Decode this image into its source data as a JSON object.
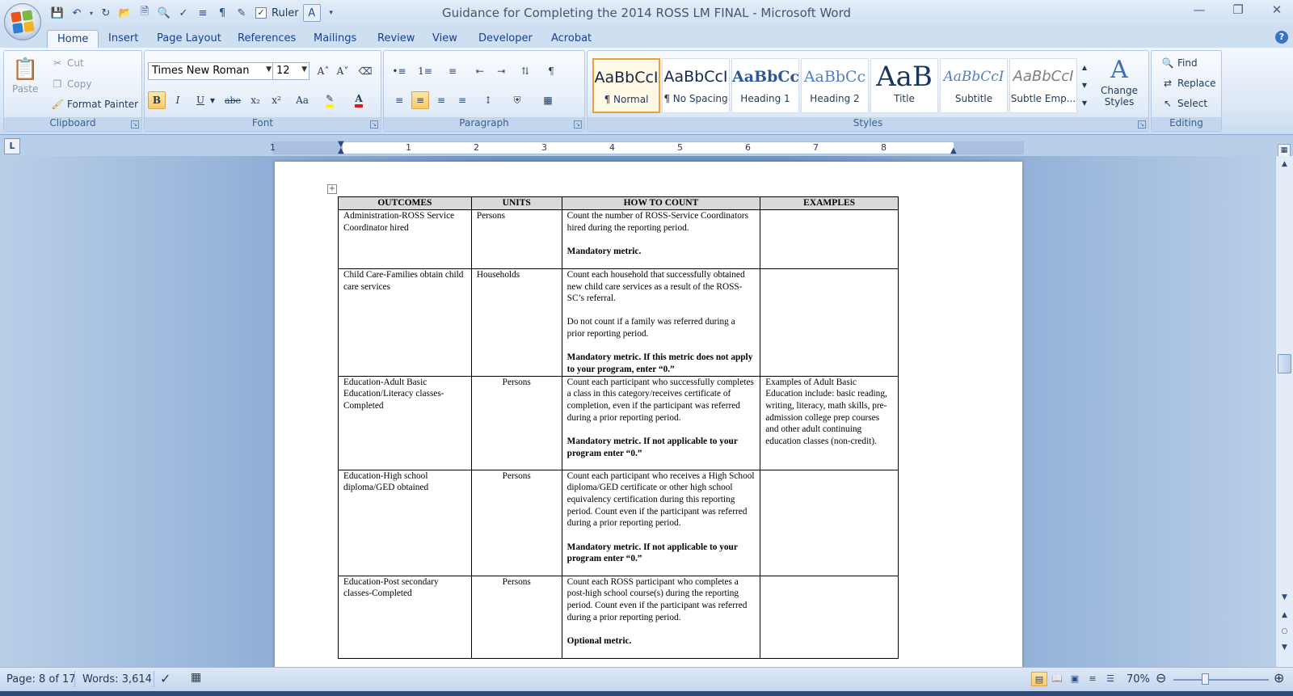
{
  "window": {
    "title": "Guidance for Completing the 2014 ROSS LM FINAL - Microsoft Word",
    "controls": [
      "—",
      "❐",
      "✕"
    ]
  },
  "qat": {
    "ruler_label": "Ruler"
  },
  "tabs": [
    "Home",
    "Insert",
    "Page Layout",
    "References",
    "Mailings",
    "Review",
    "View",
    "Developer",
    "Acrobat"
  ],
  "ribbon": {
    "clipboard": {
      "label": "Clipboard",
      "paste": "Paste",
      "cut": "Cut",
      "copy": "Copy",
      "format_painter": "Format Painter"
    },
    "font": {
      "label": "Font",
      "family": "Times New Roman",
      "size": "12",
      "bold": "B",
      "italic": "I",
      "underline": "U",
      "strike": "abe",
      "subscript": "x₂",
      "superscript": "x²",
      "case": "Aa",
      "grow": "A˄",
      "shrink": "A˅"
    },
    "paragraph": {
      "label": "Paragraph"
    },
    "styles": {
      "label": "Styles",
      "items": [
        {
          "sample": "AaBbCcI",
          "name": "¶ Normal"
        },
        {
          "sample": "AaBbCcI",
          "name": "¶ No Spacing"
        },
        {
          "sample": "AaBbCc",
          "name": "Heading 1"
        },
        {
          "sample": "AaBbCc",
          "name": "Heading 2"
        },
        {
          "sample": "AaB",
          "name": "Title"
        },
        {
          "sample": "AaBbCcI",
          "name": "Subtitle"
        },
        {
          "sample": "AaBbCcI",
          "name": "Subtle Emp..."
        }
      ],
      "change_styles": "Change Styles"
    },
    "editing": {
      "label": "Editing",
      "find": "Find",
      "replace": "Replace",
      "select": "Select"
    }
  },
  "ruler": {
    "numbers": [
      "1",
      "1",
      "2",
      "3",
      "4",
      "5",
      "6",
      "7",
      "8"
    ]
  },
  "table": {
    "headers": [
      "OUTCOMES",
      "UNITS",
      "HOW TO COUNT",
      "EXAMPLES"
    ],
    "rows": [
      {
        "outcome": "Administration-ROSS Service Coordinator hired",
        "units": "Persons",
        "how": [
          "Count the number of ROSS-Service Coordinators hired during the reporting period."
        ],
        "how_bold": "Mandatory metric.",
        "examples": ""
      },
      {
        "outcome": "Child Care-Families obtain child care services",
        "units": "Households",
        "how": [
          "Count each household that successfully obtained new child care services as a result of the ROSS-SC’s referral.",
          "Do not count if a family was referred during a prior reporting period."
        ],
        "how_bold": "Mandatory metric.  If this metric does not apply to your program, enter “0.”",
        "examples": ""
      },
      {
        "outcome": "Education-Adult Basic Education/Literacy classes-Completed",
        "units": "Persons",
        "how": [
          "Count each participant who successfully completes a class in this category/receives certificate of completion, even if the participant was referred during a prior reporting period."
        ],
        "how_bold": "Mandatory metric.  If not applicable to your program enter “0.”",
        "examples": "Examples of Adult Basic Education include: basic reading, writing, literacy, math skills, pre-admission college prep courses and other adult continuing education classes (non-credit)."
      },
      {
        "outcome": "Education-High school diploma/GED obtained",
        "units": "Persons",
        "how": [
          "Count each participant who receives a High School diploma/GED certificate or other high school equivalency certification during this reporting period.  Count even if the participant was referred during a prior reporting period."
        ],
        "how_bold": "Mandatory metric.  If not applicable to your program enter “0.”",
        "examples": ""
      },
      {
        "outcome": "Education-Post secondary classes-Completed",
        "units": "Persons",
        "how": [
          "Count each ROSS participant who completes a post-high school course(s) during the reporting period. Count even if the participant was referred during a prior reporting period."
        ],
        "how_bold": "Optional metric.",
        "examples": ""
      }
    ]
  },
  "status": {
    "page": "Page: 8 of 17",
    "words": "Words: 3,614",
    "zoom": "70%"
  },
  "zoom_level": 0.7,
  "colors": {
    "accent": "#15428b",
    "ribbon_bg": "#dbe7f6",
    "selected": "#f8c96a",
    "doc_bg": "#6c92c6"
  }
}
